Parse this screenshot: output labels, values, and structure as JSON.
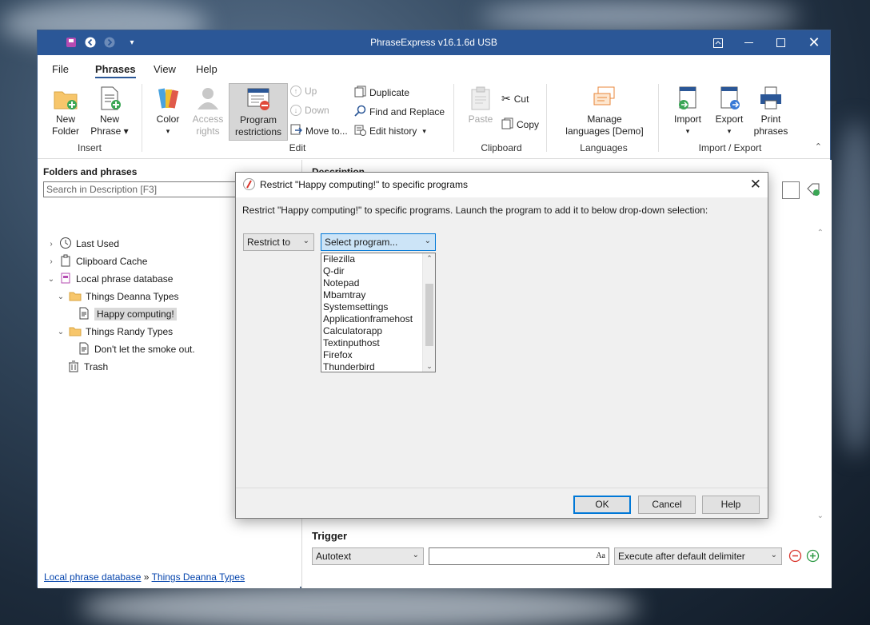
{
  "window": {
    "title": "PhraseExpress v16.1.6d USB"
  },
  "menu": {
    "file": "File",
    "phrases": "Phrases",
    "view": "View",
    "help": "Help"
  },
  "ribbon": {
    "new_folder": "New\nFolder",
    "new_phrase": "New\nPhrase ▾",
    "color": "Color",
    "access_rights": "Access\nrights",
    "program_restrictions": "Program\nrestrictions",
    "up": "Up",
    "down": "Down",
    "move_to": "Move to...",
    "duplicate": "Duplicate",
    "find_replace": "Find and Replace",
    "edit_history": "Edit history",
    "paste": "Paste",
    "cut": "Cut",
    "copy": "Copy",
    "manage_languages": "Manage\nlanguages [Demo]",
    "import": "Import",
    "export": "Export",
    "print_phrases": "Print\nphrases",
    "groups": {
      "insert": "Insert",
      "edit": "Edit",
      "clipboard": "Clipboard",
      "languages": "Languages",
      "import_export": "Import / Export"
    }
  },
  "left_pane": {
    "title": "Folders and phrases",
    "search_placeholder": "Search in Description [F3]",
    "tree": {
      "last_used": "Last Used",
      "clipboard_cache": "Clipboard Cache",
      "local_db": "Local phrase database",
      "things_deanna": "Things Deanna Types",
      "happy_computing": "Happy computing!",
      "things_randy": "Things Randy Types",
      "dont_let": "Don't let the smoke out.",
      "trash": "Trash"
    },
    "breadcrumb": {
      "root": "Local phrase database",
      "sep": " » ",
      "current": "Things Deanna Types"
    }
  },
  "right_pane": {
    "description_label": "Description",
    "trigger_label": "Trigger",
    "trigger_type": "Autotext",
    "trigger_text": "",
    "trigger_input_icon": "Aa",
    "execute_option": "Execute after default delimiter"
  },
  "dialog": {
    "title": "Restrict \"Happy computing!\" to specific programs",
    "message": "Restrict \"Happy computing!\" to specific programs. Launch the program to add it to below drop-down selection:",
    "restrict_combo": "Restrict to",
    "program_combo": "Select program...",
    "programs": [
      "Filezilla",
      "Q-dir",
      "Notepad",
      "Mbamtray",
      "Systemsettings",
      "Applicationframehost",
      "Calculatorapp",
      "Textinputhost",
      "Firefox",
      "Thunderbird"
    ],
    "ok": "OK",
    "cancel": "Cancel",
    "help": "Help"
  }
}
